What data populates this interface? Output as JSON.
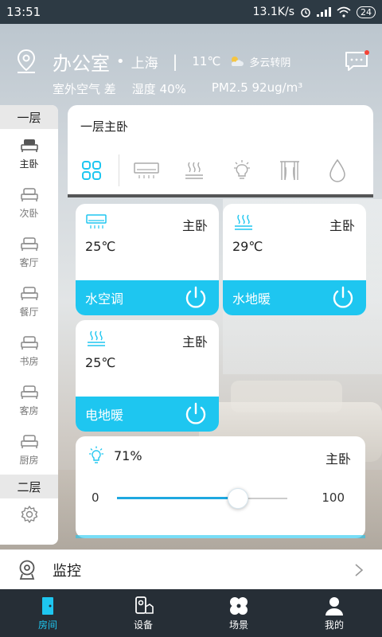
{
  "status_bar": {
    "time": "13:51",
    "net_speed": "13.1K/s",
    "battery": "24"
  },
  "header": {
    "room_name": "办公室",
    "dot": "•",
    "city": "上海",
    "separator": "|",
    "temperature": "11℃",
    "weather": "多云转阴",
    "air_quality": "室外空气 差",
    "humidity": "湿度 40%",
    "pm25": "PM2.5 92ug/m³"
  },
  "sidebar": {
    "floor1_label": "一层",
    "floor2_label": "二层",
    "items": [
      {
        "label": "主卧",
        "active": true
      },
      {
        "label": "次卧"
      },
      {
        "label": "客厅"
      },
      {
        "label": "餐厅"
      },
      {
        "label": "书房"
      },
      {
        "label": "客房"
      },
      {
        "label": "厨房"
      }
    ]
  },
  "panel": {
    "title": "一层主卧",
    "categories": [
      "all-grid-icon",
      "air-conditioner-icon",
      "floor-heating-icon",
      "light-bulb-icon",
      "curtain-icon",
      "water-drop-icon"
    ]
  },
  "devices": [
    {
      "room": "主卧",
      "value": "25℃",
      "name": "水空调",
      "icon": "air-conditioner-icon"
    },
    {
      "room": "主卧",
      "value": "29℃",
      "name": "水地暖",
      "icon": "floor-heating-icon"
    },
    {
      "room": "主卧",
      "value": "25℃",
      "name": "电地暖",
      "icon": "floor-heating-icon"
    }
  ],
  "light": {
    "percent": "71%",
    "room": "主卧",
    "min": "0",
    "max": "100",
    "level": 71
  },
  "monitor": {
    "label": "监控"
  },
  "nav": [
    {
      "label": "房间",
      "active": true
    },
    {
      "label": "设备"
    },
    {
      "label": "场景"
    },
    {
      "label": "我的"
    }
  ],
  "colors": {
    "accent": "#1ec6f0",
    "status_bar": "#2d3a44",
    "nav_bg": "#262e36"
  }
}
